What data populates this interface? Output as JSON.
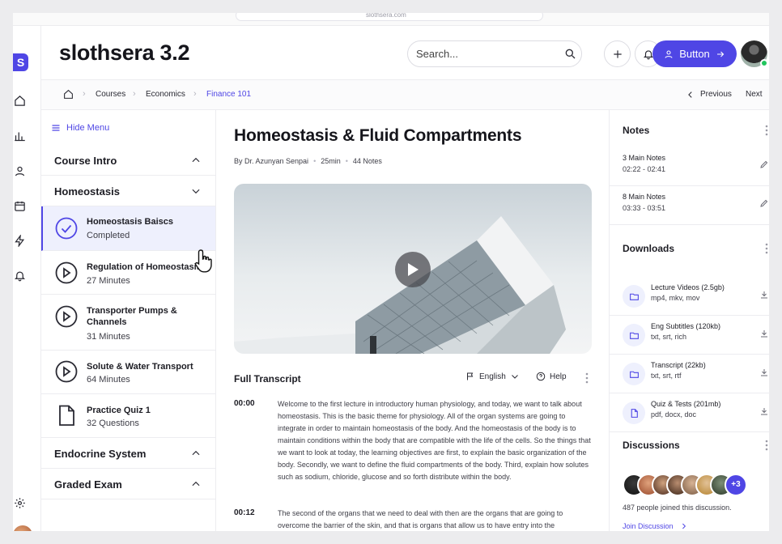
{
  "app": {
    "title": "slothsera 3.2",
    "logo_letter": "S"
  },
  "header": {
    "search_placeholder": "Search...",
    "button_label": "Button"
  },
  "breadcrumb": {
    "items": [
      "Courses",
      "Economics",
      "Finance 101"
    ],
    "previous": "Previous",
    "next": "Next"
  },
  "menu": {
    "hide_label": "Hide Menu",
    "sections": [
      "Course Intro",
      "Homeostasis",
      "Endocrine System",
      "Graded Exam"
    ],
    "lessons": [
      {
        "title": "Homeostasis Baiscs",
        "sub": "Completed"
      },
      {
        "title": "Regulation of Homeostasis",
        "sub": "27 Minutes"
      },
      {
        "title": "Transporter Pumps & Channels",
        "sub": "31 Minutes"
      },
      {
        "title": "Solute & Water Transport",
        "sub": "64 Minutes"
      },
      {
        "title": "Practice Quiz 1",
        "sub": "32 Questions"
      }
    ]
  },
  "lesson": {
    "title": "Homeostasis & Fluid Compartments",
    "author": "By Dr. Azunyan Senpai",
    "duration": "25min",
    "notes_count": "44 Notes"
  },
  "transcript": {
    "heading": "Full Transcript",
    "language": "English",
    "help": "Help",
    "entries": [
      {
        "time": "00:00",
        "text": "Welcome to the first lecture in introductory human physiology, and today, we want to talk about homeostasis. This is the basic theme for physiology. All of the organ systems are going to integrate in order to maintain homeostasis of the body. And the homeostasis of the body is to maintain conditions within the body that are compatible with the life of the cells. So the things that we want to look at today, the learning objectives are first, to explain the basic organization of the body. Secondly, we want to define the fluid compartments of the body. Third, explain how solutes such as sodium, chloride, glucose and so forth distribute within the body."
      },
      {
        "time": "00:12",
        "text": "The second of the organs that we need to deal with then are the organs that are going to overcome the barrier of the skin, and that is organs that allow us to have entry into the"
      }
    ]
  },
  "notes": {
    "heading": "Notes",
    "items": [
      {
        "title": "3 Main Notes",
        "range": "02:22 - 02:41"
      },
      {
        "title": "8 Main Notes",
        "range": "03:33 - 03:51"
      }
    ]
  },
  "downloads": {
    "heading": "Downloads",
    "items": [
      {
        "title": "Lecture Videos (2.5gb)",
        "formats": "mp4, mkv, mov",
        "icon": "folder-icon"
      },
      {
        "title": "Eng Subtitles (120kb)",
        "formats": "txt, srt, rich",
        "icon": "folder-icon"
      },
      {
        "title": "Transcript (22kb)",
        "formats": "txt, srt, rtf",
        "icon": "folder-icon"
      },
      {
        "title": "Quiz & Tests (201mb)",
        "formats": "pdf, docx, doc",
        "icon": "file-icon"
      }
    ]
  },
  "discussions": {
    "heading": "Discussions",
    "more_count": "+3",
    "joined_text": "487 people joined this discussion.",
    "join_label": "Join Discussion"
  },
  "colors": {
    "accent": "#4f46e5",
    "online": "#22c55e"
  }
}
